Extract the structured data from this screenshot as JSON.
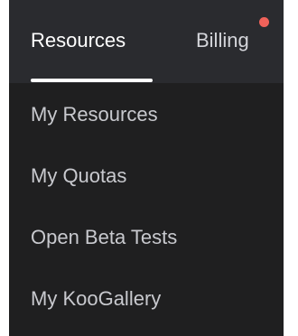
{
  "tabs": {
    "resources_label": "Resources",
    "billing_label": "Billing"
  },
  "menu": {
    "items": [
      {
        "label": "My Resources"
      },
      {
        "label": "My Quotas"
      },
      {
        "label": "Open Beta Tests"
      },
      {
        "label": "My KooGallery"
      }
    ]
  },
  "colors": {
    "tab_bar_bg": "#2a2b2f",
    "menu_bg": "#1f1f20",
    "active_underline": "#ffffff",
    "badge": "#f0625a",
    "item_text": "#c8c9ce"
  }
}
